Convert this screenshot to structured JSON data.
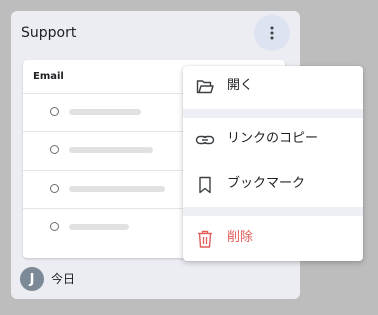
{
  "card": {
    "title": "Support",
    "column_header": "Email",
    "rows": [
      {
        "placeholder_width": 72
      },
      {
        "placeholder_width": 84
      },
      {
        "placeholder_width": 96
      },
      {
        "placeholder_width": 60
      }
    ],
    "avatar_initial": "J",
    "date_label": "今日"
  },
  "menu": {
    "items": [
      {
        "label": "開く",
        "icon": "folder-icon"
      },
      {
        "label": "リンクのコピー",
        "icon": "link-icon"
      },
      {
        "label": "ブックマーク",
        "icon": "bookmark-icon"
      },
      {
        "label": "削除",
        "icon": "trash-icon"
      }
    ]
  },
  "colors": {
    "background": "#bdbdbd",
    "card": "#ecedf3",
    "more_button": "#dde3f1",
    "avatar": "#7c8a97",
    "danger": "#e35d59"
  }
}
